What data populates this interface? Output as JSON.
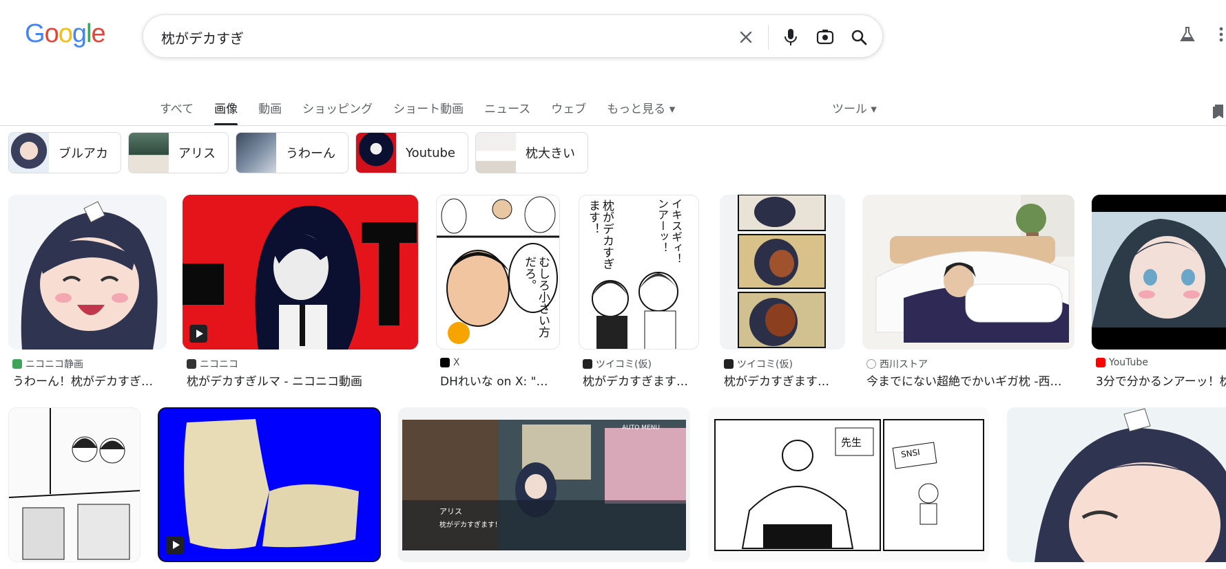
{
  "logo": {
    "text": "Google"
  },
  "search": {
    "query": "枕がデカすぎ"
  },
  "tabs": [
    "すべて",
    "画像",
    "動画",
    "ショッピング",
    "ショート動画",
    "ニュース",
    "ウェブ",
    "もっと見る ▾"
  ],
  "tools": "ツール ▾",
  "chips": [
    {
      "label": "ブルアカ"
    },
    {
      "label": "アリス"
    },
    {
      "label": "うわーん"
    },
    {
      "label": "Youtube"
    },
    {
      "label": "枕大きい"
    }
  ],
  "results_row1": [
    {
      "source": "ニコニコ静画",
      "title": "うわーん！枕がデカすぎ…"
    },
    {
      "source": "ニコニコ",
      "title": "枕がデカすぎルマ - ニコニコ動画"
    },
    {
      "source": "X",
      "title": "DHれいな on X: \"…"
    },
    {
      "source": "ツイコミ(仮)",
      "title": "枕がデカすぎます…"
    },
    {
      "source": "ツイコミ(仮)",
      "title": "枕がデカすぎます…"
    },
    {
      "source": "西川ストア",
      "title": "今までにない超絶でかいギガ枕 -西…"
    },
    {
      "source": "YouTube",
      "title": "3分で分かるンアーッ！枕"
    }
  ],
  "image_text": {
    "manga1": "枕がデカすぎます！",
    "manga2": "むしろ小さい方だろ。",
    "manga3": "イキスギィ！ンアーッ！",
    "game_name": "アリス",
    "game_line": "枕がデカすぎます！",
    "game_menu": "AUTO  MENU",
    "manga4": "先生",
    "manga5": "SNSI"
  },
  "colors": {
    "accent": "#1a73e8",
    "niconico_red": "#e5141a",
    "youtube_red": "#ff0000",
    "blue_bg": "#0000ff"
  }
}
